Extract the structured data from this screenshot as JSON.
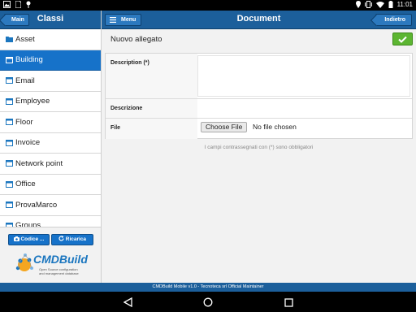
{
  "status_bar": {
    "time": "11:01",
    "icons": [
      "image-icon",
      "sim-icon",
      "pin-icon",
      "location-icon",
      "vibrate-icon",
      "wifi-icon",
      "battery-icon"
    ]
  },
  "left_panel": {
    "back_label": "Main",
    "title": "Classi",
    "items": [
      {
        "label": "Asset",
        "icon": "folder-icon",
        "selected": false
      },
      {
        "label": "Building",
        "icon": "table-icon",
        "selected": true
      },
      {
        "label": "Email",
        "icon": "table-icon",
        "selected": false
      },
      {
        "label": "Employee",
        "icon": "table-icon",
        "selected": false
      },
      {
        "label": "Floor",
        "icon": "table-icon",
        "selected": false
      },
      {
        "label": "Invoice",
        "icon": "table-icon",
        "selected": false
      },
      {
        "label": "Network point",
        "icon": "table-icon",
        "selected": false
      },
      {
        "label": "Office",
        "icon": "table-icon",
        "selected": false
      },
      {
        "label": "ProvaMarco",
        "icon": "table-icon",
        "selected": false
      },
      {
        "label": "Groups",
        "icon": "table-icon",
        "selected": false
      }
    ],
    "codice_label": "Codice ...",
    "ricarica_label": "Ricarica",
    "logo_text": "CMDBuild",
    "logo_sub_1": "Open Source configuration",
    "logo_sub_2": "and management database"
  },
  "main_panel": {
    "menu_label": "Menu",
    "title": "Document",
    "back_label": "Indietro",
    "attachment_label": "Nuovo allegato",
    "form": {
      "description_required_label": "Description (*)",
      "descrizione_label": "Descrizione",
      "file_label": "File",
      "file_button": "Choose File",
      "file_status": "No file chosen"
    },
    "hint": "I campi contrassegnati con (*) sono obbligatori"
  },
  "info_bar": "CMDBuild Mobile v1.0 - Tecnoteca srl Official Maintainer",
  "colors": {
    "header": "#1c5f9b",
    "selected": "#1672c9",
    "confirm": "#5cb531"
  }
}
